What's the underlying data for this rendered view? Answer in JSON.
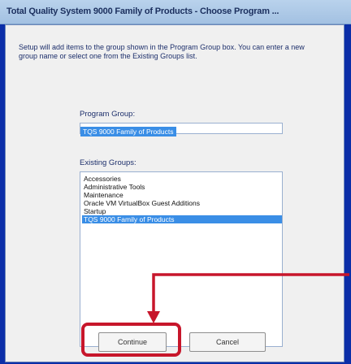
{
  "window": {
    "title": "Total Quality System 9000 Family of Products - Choose Program ..."
  },
  "dialog": {
    "instructions": "Setup will add items to the group shown in the Program Group box. You can enter a new group name or select one from the Existing Groups list.",
    "program_group_label": "Program Group:",
    "program_group_value": "TQS 9000 Family of Products",
    "existing_groups_label": "Existing Groups:",
    "existing_groups": [
      "Accessories",
      "Administrative Tools",
      "Maintenance",
      "Oracle VM VirtualBox Guest Additions",
      "Startup",
      "TQS 9000 Family of Products"
    ],
    "selected_group": "TQS 9000 Family of Products"
  },
  "buttons": {
    "continue_label": "Continue",
    "cancel_label": "Cancel"
  },
  "annotation": {
    "color": "#c7162b"
  }
}
